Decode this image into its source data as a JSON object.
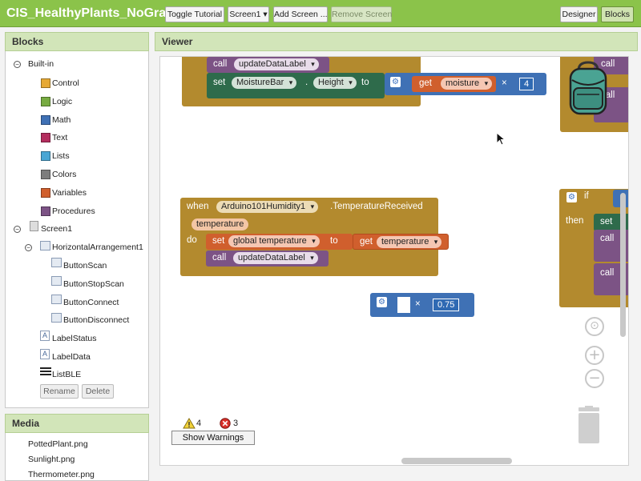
{
  "topbar": {
    "project_title": "CIS_HealthyPlants_NoGraph",
    "toggle_tutorial": "Toggle Tutorial",
    "screen_select": "Screen1 ▾",
    "add_screen": "Add Screen ...",
    "remove_screen": "Remove Screen",
    "designer": "Designer",
    "blocks": "Blocks"
  },
  "blocks_panel": {
    "title": "Blocks",
    "builtin_label": "Built-in",
    "builtin_items": [
      {
        "label": "Control",
        "color": "#e6a935"
      },
      {
        "label": "Logic",
        "color": "#77ab41"
      },
      {
        "label": "Math",
        "color": "#3f71b5"
      },
      {
        "label": "Text",
        "color": "#b32d5e"
      },
      {
        "label": "Lists",
        "color": "#49a6d4"
      },
      {
        "label": "Colors",
        "color": "#7d7d7d"
      },
      {
        "label": "Variables",
        "color": "#d05f2d"
      },
      {
        "label": "Procedures",
        "color": "#7c5385"
      }
    ],
    "screen_label": "Screen1",
    "arrangement_label": "HorizontalArrangement1",
    "buttons": [
      "ButtonScan",
      "ButtonStopScan",
      "ButtonConnect",
      "ButtonDisconnect"
    ],
    "labels": [
      "LabelStatus",
      "LabelData"
    ],
    "list_ble": "ListBLE",
    "rename_button": "Rename",
    "delete_button": "Delete"
  },
  "media_panel": {
    "title": "Media",
    "files": [
      "PottedPlant.png",
      "Sunlight.png",
      "Thermometer.png"
    ]
  },
  "viewer": {
    "title": "Viewer",
    "block1": {
      "call": "call",
      "proc": "updateDataLabel",
      "set": "set",
      "component": "MoistureBar",
      "dot": ".",
      "property": "Height",
      "to": "to",
      "get": "get",
      "var": "moisture",
      "times": "×",
      "number": "4"
    },
    "block2": {
      "when": "when",
      "component": "Arduino101Humidity1",
      "event": ".TemperatureReceived",
      "param": "temperature",
      "do": "do",
      "set": "set",
      "var": "global temperature",
      "to": "to",
      "get": "get",
      "get_var": "temperature",
      "call": "call",
      "proc": "updateDataLabel"
    },
    "block3": {
      "times": "×",
      "number": "0.75"
    },
    "right_blocks": {
      "call1": "call",
      "call2": "call",
      "if": "if",
      "then": "then",
      "set": "set",
      "call3": "call",
      "call4": "call"
    },
    "warnings_count": "4",
    "errors_count": "3",
    "show_warnings": "Show Warnings"
  },
  "colors": {
    "topbar": "#8bc34a",
    "control": "#b38a2e",
    "procedure": "#7c5385",
    "setter": "#2e6b4b",
    "variable": "#d05f2d",
    "math": "#3f71b5"
  }
}
